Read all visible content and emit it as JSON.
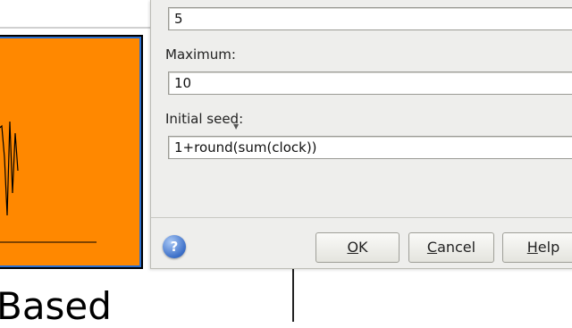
{
  "dialog": {
    "fields": [
      {
        "label": "",
        "value": "5"
      },
      {
        "label": "Maximum:",
        "value": "10"
      },
      {
        "label": "Initial seed:",
        "value": "1+round(sum(clock))"
      }
    ],
    "buttons": {
      "ok": {
        "mnemonic": "O",
        "rest": "K"
      },
      "cancel": {
        "mnemonic": "C",
        "rest": "ancel"
      },
      "help": {
        "mnemonic": "H",
        "rest": "elp"
      }
    },
    "help_icon_glyph": "?"
  },
  "background": {
    "block_label_fragment": "Based",
    "block_color": "#ff8800"
  }
}
